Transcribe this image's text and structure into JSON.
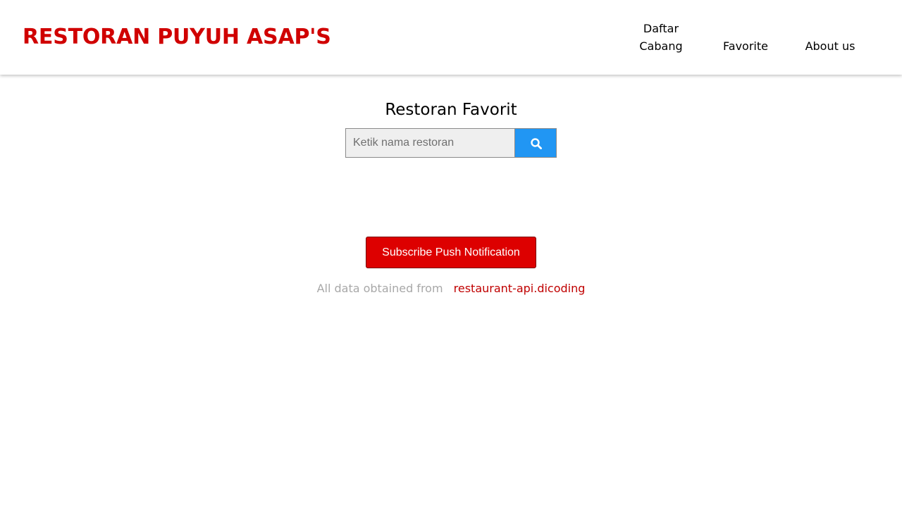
{
  "header": {
    "brand": "RESTORAN PUYUH ASAP'S",
    "nav": {
      "daftar_cabang": "Daftar Cabang",
      "favorite": "Favorite",
      "about": "About us"
    }
  },
  "main": {
    "title": "Restoran Favorit",
    "search": {
      "placeholder": "Ketik nama restoran",
      "value": "",
      "button_icon": "search-icon"
    },
    "subscribe_label": "Subscribe Push Notification"
  },
  "footer": {
    "text": "All data obtained from",
    "link_text": "restaurant-api.dicoding"
  },
  "colors": {
    "brand": "#d00000",
    "search_button": "#2196f3",
    "subscribe_button": "#dd0000",
    "footer_link": "#c00000",
    "footer_text": "#a8a8a8"
  }
}
